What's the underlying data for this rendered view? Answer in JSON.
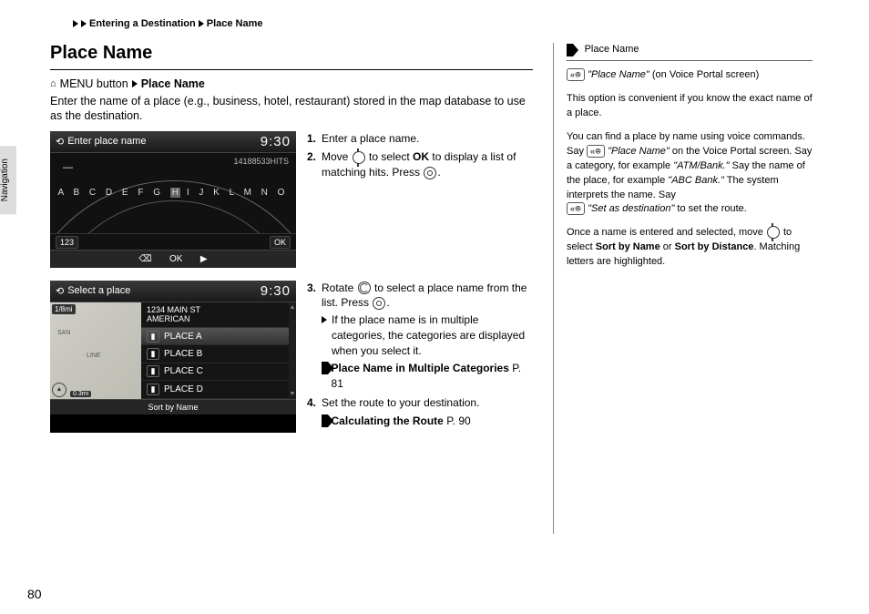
{
  "breadcrumb": {
    "a": "Entering a Destination",
    "b": "Place Name"
  },
  "title": "Place Name",
  "menu_line": {
    "button_text": "MENU button",
    "target": "Place Name"
  },
  "intro": "Enter the name of a place (e.g., business, hotel, restaurant) stored in the map database to use as the destination.",
  "screen1": {
    "header": "Enter place name",
    "time": "9:30",
    "hits": "14188533HITS",
    "cursor": "—",
    "letters_pre": "A B C D E F G",
    "letters_hl": "H",
    "letters_post": "I   J  K  L  M  N  O",
    "btn_left": "123",
    "btn_right": "OK",
    "footer_l": "⌫",
    "footer_c": "OK",
    "footer_r": "▶"
  },
  "screen2": {
    "header": "Select a place",
    "time": "9:30",
    "dist_badge": "1/8mi",
    "map_label1": "SAN",
    "map_label2": "LINE",
    "scale": "0.3mi",
    "addr_line1": "1234 MAIN ST",
    "addr_line2": "AMERICAN",
    "items": [
      "PLACE A",
      "PLACE B",
      "PLACE C",
      "PLACE D"
    ],
    "footer_center": "Sort by Name"
  },
  "steps": {
    "s1": "Enter a place name.",
    "s2a": "Move ",
    "s2b": " to select ",
    "s2ok": "OK",
    "s2c": " to display a list of matching hits. Press ",
    "s2d": ".",
    "s3a": "Rotate ",
    "s3b": " to select a place name from the list. Press ",
    "s3c": ".",
    "s3_sub": "If the place name is in multiple categories, the categories are displayed when you select it.",
    "s3_xref": "Place Name in Multiple Categories",
    "s3_xref_p": " P. 81",
    "s4": "Set the route to your destination.",
    "s4_xref": "Calculating the Route",
    "s4_xref_p": " P. 90"
  },
  "side": {
    "title": "Place Name",
    "voice_phrase": "\"Place Name\"",
    "voice_suffix": " (on Voice Portal screen)",
    "p1": "This option is convenient if you know the exact name of a place.",
    "p2a": "You can find a place by name using voice commands. Say ",
    "p2b": " on the Voice Portal screen. Say a category, for example ",
    "p2cat": "\"ATM/Bank.\"",
    "p2c": " Say the name of the place, for example ",
    "p2bank": "\"ABC Bank.\"",
    "p2d": " The system interprets the name. Say ",
    "p2set": "\"Set as destination\"",
    "p2e": " to set the route.",
    "p3a": "Once a name is entered and selected, move ",
    "p3b": " to select ",
    "p3s1": "Sort by Name",
    "p3c": " or ",
    "p3s2": "Sort by Distance",
    "p3d": ". Matching letters are highlighted."
  },
  "side_tab": "Navigation",
  "page_number": "80"
}
